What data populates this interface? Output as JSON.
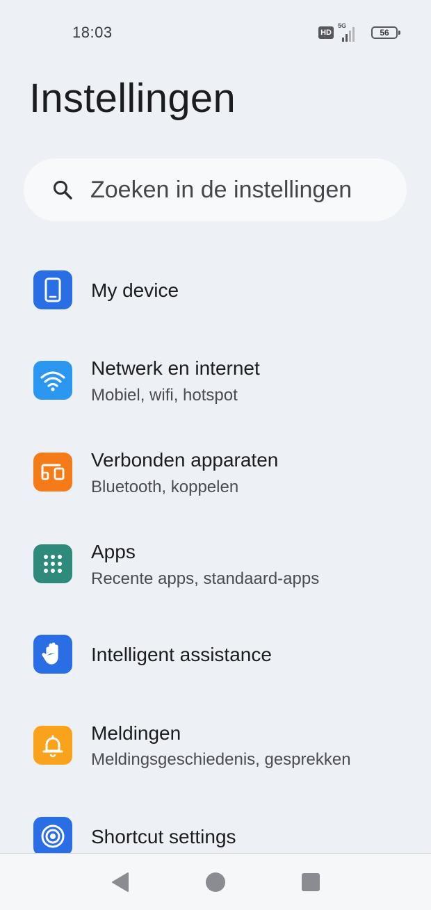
{
  "status_bar": {
    "time": "18:03",
    "network": "5G",
    "hd_label": "HD",
    "battery_level": "56"
  },
  "page": {
    "title": "Instellingen"
  },
  "search": {
    "placeholder": "Zoeken in de instellingen"
  },
  "settings": [
    {
      "title": "My device",
      "subtitle": "",
      "icon": "phone-icon",
      "color": "#2a6ee6"
    },
    {
      "title": "Netwerk en internet",
      "subtitle": "Mobiel, wifi, hotspot",
      "icon": "wifi-icon",
      "color": "#2b97f0"
    },
    {
      "title": "Verbonden apparaten",
      "subtitle": "Bluetooth, koppelen",
      "icon": "connected-devices-icon",
      "color": "#f47b17"
    },
    {
      "title": "Apps",
      "subtitle": "Recente apps, standaard-apps",
      "icon": "apps-grid-icon",
      "color": "#2e8a7a"
    },
    {
      "title": "Intelligent assistance",
      "subtitle": "",
      "icon": "hand-icon",
      "color": "#2a6ee6"
    },
    {
      "title": "Meldingen",
      "subtitle": "Meldingsgeschiedenis, gesprekken",
      "icon": "bell-icon",
      "color": "#f9a21b"
    },
    {
      "title": "Shortcut settings",
      "subtitle": "",
      "icon": "shortcut-icon",
      "color": "#2a6ee6"
    }
  ],
  "nav_bar": {
    "back": "back-icon",
    "home": "home-icon",
    "recents": "recents-icon"
  }
}
